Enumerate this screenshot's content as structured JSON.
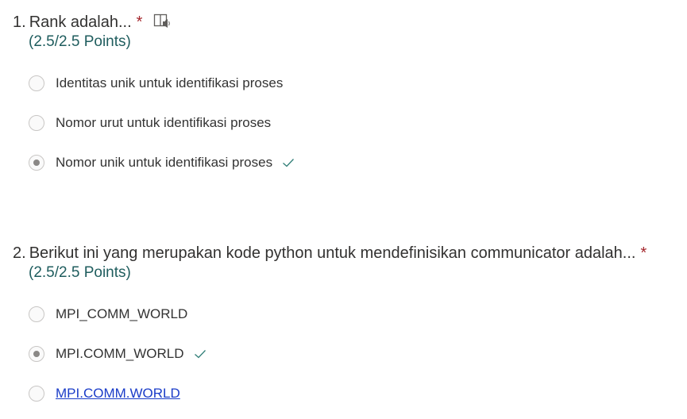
{
  "questions": [
    {
      "number": "1.",
      "title": "Rank adalah...",
      "required_mark": "*",
      "has_immersive_reader": true,
      "points": "(2.5/2.5 Points)",
      "options": [
        {
          "label": "Identitas unik untuk identifikasi proses",
          "selected": false,
          "correct": false
        },
        {
          "label": "Nomor urut untuk identifikasi proses",
          "selected": false,
          "correct": false
        },
        {
          "label": "Nomor unik untuk identifikasi proses",
          "selected": true,
          "correct": true
        }
      ]
    },
    {
      "number": "2.",
      "title": "Berikut ini yang merupakan kode python untuk mendefinisikan communicator adalah...",
      "required_mark": "*",
      "has_immersive_reader": false,
      "points": "(2.5/2.5 Points)",
      "options": [
        {
          "label": "MPI_COMM_WORLD",
          "selected": false,
          "correct": false
        },
        {
          "label": "MPI.COMM_WORLD",
          "selected": true,
          "correct": true
        },
        {
          "label": "MPI.COMM.WORLD",
          "selected": false,
          "correct": false,
          "link_style": true
        }
      ]
    }
  ],
  "icons": {
    "immersive_reader": "immersive-reader-icon",
    "correct": "checkmark-icon"
  },
  "colors": {
    "points": "#1f5d5e",
    "required": "#a4262c",
    "checkmark": "#2e7d76",
    "link": "#1a3cc8"
  }
}
